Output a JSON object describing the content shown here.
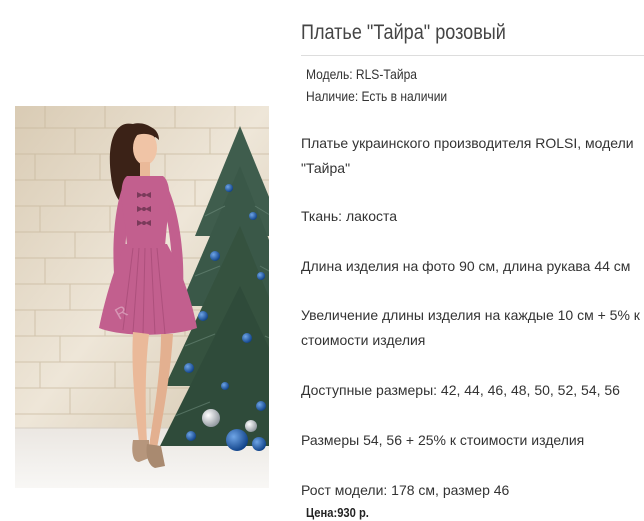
{
  "product": {
    "title": "Платье \"Тайра\" розовый",
    "model_label": "Модель:",
    "model_value": "RLS-Тайра",
    "availability_label": "Наличие:",
    "availability_value": "Есть в наличии"
  },
  "description": {
    "line1a": "Платье украинского производителя ROLSI, модели",
    "line1b": "\"Тайра\"",
    "fabric": "Ткань:  лакоста",
    "length": "Длина изделия на фото 90 см, длина рукава 44 см",
    "extra_a": "Увеличение длины изделия на каждые 10 см +  5% к",
    "extra_b": "стоимости изделия",
    "sizes": "Доступные размеры: 42, 44, 46, 48, 50, 52, 54, 56",
    "sizes_extra": "Размеры 54, 56 +  25% к стоимости изделия",
    "model_height": "Рост модели: 178 см, размер 46"
  },
  "price": {
    "label": "Цена:",
    "value": "930 р."
  },
  "colors": {
    "dress": "#c25f8e",
    "tree": "#3d5a4c",
    "ornament": "#1f5ea8",
    "wall": "#e6dccb"
  }
}
